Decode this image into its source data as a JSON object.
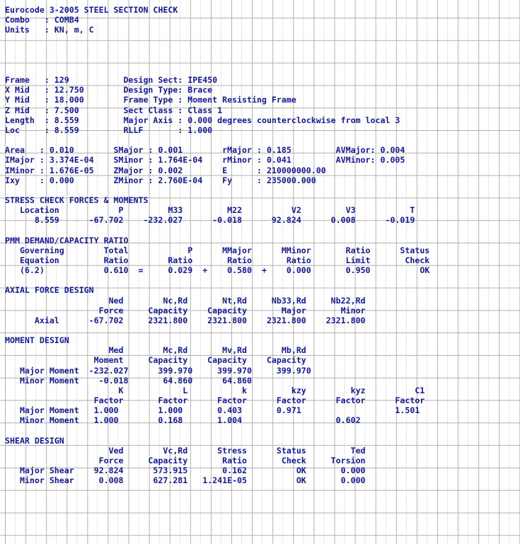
{
  "document": {
    "title": "Eurocode 3-2005 STEEL SECTION CHECK",
    "combo_label": "Combo",
    "combo_value": "COMB4",
    "units_label": "Units",
    "units_value": "KN, m, C",
    "text_color": "#11189e",
    "grid_color": "#b0b0b0",
    "background_color": "#ffffff"
  },
  "frame_info": {
    "left": [
      {
        "label": "Frame",
        "value": "129"
      },
      {
        "label": "X Mid",
        "value": "12.750"
      },
      {
        "label": "Y Mid",
        "value": "18.000"
      },
      {
        "label": "Z Mid",
        "value": "7.500"
      },
      {
        "label": "Length",
        "value": "8.559"
      },
      {
        "label": "Loc",
        "value": "8.559"
      }
    ],
    "right": [
      {
        "label": "Design Sect",
        "value": "IPE450"
      },
      {
        "label": "Design Type",
        "value": "Brace"
      },
      {
        "label": "Frame Type",
        "value": "Moment Resisting Frame"
      },
      {
        "label": "Sect Class",
        "value": "Class 1"
      },
      {
        "label": "Major Axis",
        "value": "0.000 degrees counterclockwise from local 3"
      },
      {
        "label": "RLLF",
        "value": "1.000"
      }
    ]
  },
  "section_properties": {
    "col1": [
      {
        "label": "Area",
        "value": "0.010"
      },
      {
        "label": "IMajor",
        "value": "3.374E-04"
      },
      {
        "label": "IMinor",
        "value": "1.676E-05"
      },
      {
        "label": "Ixy",
        "value": "0.000"
      }
    ],
    "col2": [
      {
        "label": "SMajor",
        "value": "0.001"
      },
      {
        "label": "SMinor",
        "value": "1.764E-04"
      },
      {
        "label": "ZMajor",
        "value": "0.002"
      },
      {
        "label": "ZMinor",
        "value": "2.760E-04"
      }
    ],
    "col3": [
      {
        "label": "rMajor",
        "value": "0.185"
      },
      {
        "label": "rMinor",
        "value": "0.041"
      },
      {
        "label": "E",
        "value": "210000000.00"
      },
      {
        "label": "Fy",
        "value": "235000.000"
      }
    ],
    "col4": [
      {
        "label": "AVMajor",
        "value": "0.004"
      },
      {
        "label": "AVMinor",
        "value": "0.005"
      }
    ]
  },
  "stress_check": {
    "heading": "STRESS CHECK FORCES & MOMENTS",
    "headers": [
      "Location",
      "P",
      "M33",
      "M22",
      "V2",
      "V3",
      "T"
    ],
    "row": [
      "8.559",
      "-67.702",
      "-232.027",
      "-0.018",
      "92.824",
      "0.008",
      "-0.019"
    ]
  },
  "pmm_ratio": {
    "heading": "PMM DEMAND/CAPACITY RATIO",
    "header_line1": [
      "Governing",
      "Total",
      "",
      "P",
      "MMajor",
      "MMinor",
      "Ratio",
      "Status"
    ],
    "header_line2": [
      "Equation",
      "Ratio",
      "",
      "Ratio",
      "Ratio",
      "Ratio",
      "Limit",
      "Check"
    ],
    "row": {
      "equation": "(6.2)",
      "total_ratio": "0.610",
      "eq_sign": "=",
      "p_ratio": "0.029",
      "plus1": "+",
      "mmajor_ratio": "0.580",
      "plus2": "+",
      "mminor_ratio": "0.000",
      "ratio_limit": "0.950",
      "status": "OK"
    }
  },
  "axial_force": {
    "heading": "AXIAL FORCE DESIGN",
    "header_line1": [
      "Ned",
      "Nc,Rd",
      "Nt,Rd",
      "Nb33,Rd",
      "Nb22,Rd"
    ],
    "header_line2": [
      "Force",
      "Capacity",
      "Capacity",
      "Major",
      "Minor"
    ],
    "rows": [
      {
        "label": "Axial",
        "values": [
          "-67.702",
          "2321.800",
          "2321.800",
          "2321.800",
          "2321.800"
        ]
      }
    ]
  },
  "moment_design": {
    "heading": "MOMENT DESIGN",
    "header_line1": [
      "Med",
      "Mc,Rd",
      "Mv,Rd",
      "Mb,Rd"
    ],
    "header_line2": [
      "Moment",
      "Capacity",
      "Capacity",
      "Capacity"
    ],
    "rows": [
      {
        "label": "Major Moment",
        "values": [
          "-232.027",
          "399.970",
          "399.970",
          "399.970"
        ]
      },
      {
        "label": "Minor Moment",
        "values": [
          "-0.018",
          "64.860",
          "64.860",
          ""
        ]
      }
    ],
    "factor_header_line1": [
      "K",
      "L",
      "k",
      "kzy",
      "kyz",
      "C1"
    ],
    "factor_header_line2": [
      "Factor",
      "Factor",
      "Factor",
      "Factor",
      "Factor",
      "Factor"
    ],
    "factor_rows": [
      {
        "label": "Major Moment",
        "values": [
          "1.000",
          "1.000",
          "0.403",
          "0.971",
          "",
          "1.501"
        ]
      },
      {
        "label": "Minor Moment",
        "values": [
          "1.000",
          "0.168",
          "1.004",
          "",
          "0.602",
          ""
        ]
      }
    ]
  },
  "shear_design": {
    "heading": "SHEAR DESIGN",
    "header_line1": [
      "Ved",
      "Vc,Rd",
      "Stress",
      "Status",
      "Ted"
    ],
    "header_line2": [
      "Force",
      "Capacity",
      "Ratio",
      "Check",
      "Torsion"
    ],
    "rows": [
      {
        "label": "Major Shear",
        "values": [
          "92.824",
          "573.915",
          "0.162",
          "OK",
          "0.000"
        ]
      },
      {
        "label": "Minor Shear",
        "values": [
          "0.008",
          "627.281",
          "1.241E-05",
          "OK",
          "0.000"
        ]
      }
    ]
  },
  "rendered_lines": [
    "Eurocode 3-2005 STEEL SECTION CHECK",
    "Combo   : COMB4",
    "Units   : KN, m, C",
    "",
    "",
    "",
    "",
    "Frame   : 129           Design Sect: IPE450",
    "X Mid   : 12.750        Design Type: Brace",
    "Y Mid   : 18.000        Frame Type : Moment Resisting Frame",
    "Z Mid   : 7.500         Sect Class : Class 1",
    "Length  : 8.559         Major Axis : 0.000 degrees counterclockwise from local 3",
    "Loc     : 8.559         RLLF       : 1.000",
    "",
    "Area   : 0.010        SMajor : 0.001        rMajor : 0.185         AVMajor: 0.004",
    "IMajor : 3.374E-04    SMinor : 1.764E-04    rMinor : 0.041         AVMinor: 0.005",
    "IMinor : 1.676E-05    ZMajor : 0.002        E      : 210000000.00",
    "Ixy    : 0.000        ZMinor : 2.760E-04    Fy     : 235000.000",
    "",
    "STRESS CHECK FORCES & MOMENTS",
    "   Location            P         M33         M22          V2         V3           T",
    "      8.559      -67.702    -232.027      -0.018      92.824      0.008      -0.019",
    "",
    "PMM DEMAND/CAPACITY RATIO",
    "   Governing        Total            P      MMajor      MMinor       Ratio      Status",
    "   Equation         Ratio        Ratio       Ratio       Ratio       Limit       Check",
    "   (6.2)            0.610  =     0.029  +    0.580  +    0.000       0.950          OK",
    "",
    "AXIAL FORCE DESIGN",
    "                     Ned        Nc,Rd       Nt,Rd     Nb33,Rd     Nb22,Rd",
    "                   Force     Capacity    Capacity       Major       Minor",
    "      Axial      -67.702     2321.800    2321.800    2321.800    2321.800",
    "",
    "MOMENT DESIGN",
    "                     Med        Mc,Rd       Mv,Rd       Mb,Rd",
    "                  Moment     Capacity    Capacity    Capacity",
    "   Major Moment  -232.027      399.970     399.970     399.970",
    "   Minor Moment    -0.018       64.860      64.860",
    "                       K            L           k         kzy         kyz          C1",
    "                  Factor       Factor      Factor      Factor      Factor      Factor",
    "   Major Moment   1.000        1.000       0.403       0.971                   1.501",
    "   Minor Moment   1.000        0.168       1.004                   0.602",
    "",
    "SHEAR DESIGN",
    "                     Ved        Vc,Rd      Stress      Status         Ted",
    "                   Force     Capacity       Ratio       Check     Torsion",
    "   Major Shear    92.824      573.915       0.162          OK       0.000",
    "   Minor Shear     0.008      627.281   1.241E-05          OK       0.000"
  ]
}
